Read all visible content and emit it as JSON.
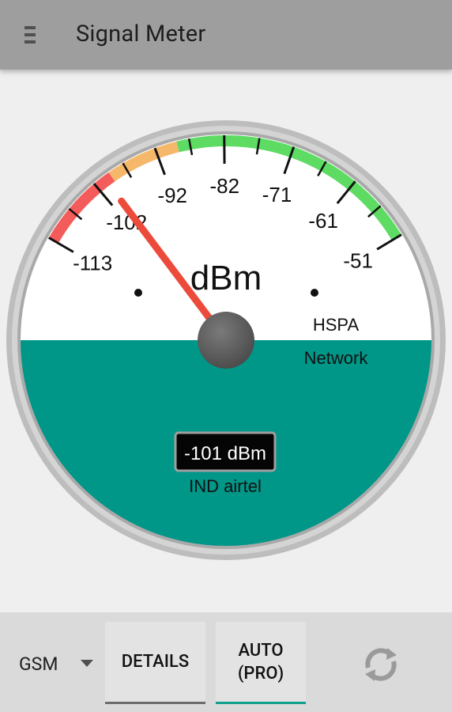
{
  "app": {
    "title": "Signal Meter"
  },
  "gauge": {
    "unit": "dBm",
    "scale_labels": [
      "-113",
      "-102",
      "-92",
      "-82",
      "-71",
      "-61",
      "-51"
    ],
    "network_type": "HSPA",
    "network_label": "Network",
    "reading": "-101 dBm",
    "reading_value": -101,
    "operator": "IND airtel",
    "colors": {
      "zone_red": "#f45b5b",
      "zone_orange": "#f5b86b",
      "zone_green": "#5ddb63",
      "needle": "#ec4b3c",
      "lower_fill": "#009688",
      "bezel": "#bdbdbd"
    }
  },
  "bottom": {
    "network_select": "GSM",
    "details_label": "DETAILS",
    "auto_label": "AUTO\n(PRO)",
    "refresh_icon": "refresh-icon"
  }
}
